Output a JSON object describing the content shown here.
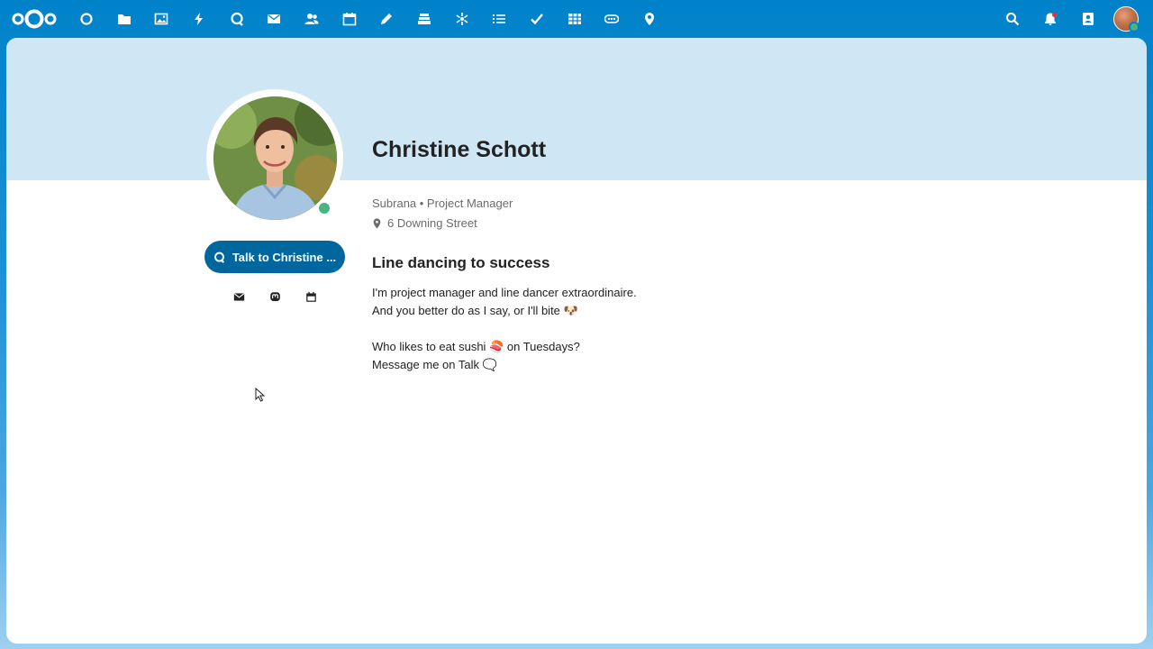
{
  "topbar": {
    "logo": "nextcloud-logo",
    "apps": [
      {
        "name": "dashboard-icon"
      },
      {
        "name": "files-icon"
      },
      {
        "name": "photos-icon"
      },
      {
        "name": "activity-icon"
      },
      {
        "name": "talk-icon"
      },
      {
        "name": "mail-icon"
      },
      {
        "name": "contacts-icon"
      },
      {
        "name": "calendar-icon"
      },
      {
        "name": "notes-icon"
      },
      {
        "name": "deck-icon"
      },
      {
        "name": "analytics-icon"
      },
      {
        "name": "tasks-icon"
      },
      {
        "name": "checkmark-icon"
      },
      {
        "name": "tables-icon"
      },
      {
        "name": "forms-icon"
      },
      {
        "name": "maps-icon"
      }
    ],
    "right_icons": [
      "search-icon",
      "notifications-icon",
      "contacts-menu-icon"
    ],
    "accent_color": "#0082c9"
  },
  "profile": {
    "name": "Christine Schott",
    "status_color": "#49b382",
    "talk_button_label": "Talk to Christine ...",
    "organisation_role": "Subrana • Project Manager",
    "address": "6 Downing Street",
    "headline": "Line dancing to success",
    "bio_lines": [
      "I'm project manager and line dancer extraordinaire.",
      "And you better do as I say, or I'll bite 🐶",
      "",
      "Who likes to eat sushi 🍣 on Tuesdays?",
      "Message me on Talk 🗨️"
    ],
    "actions": [
      "email-icon",
      "mastodon-icon",
      "calendar-icon"
    ]
  }
}
